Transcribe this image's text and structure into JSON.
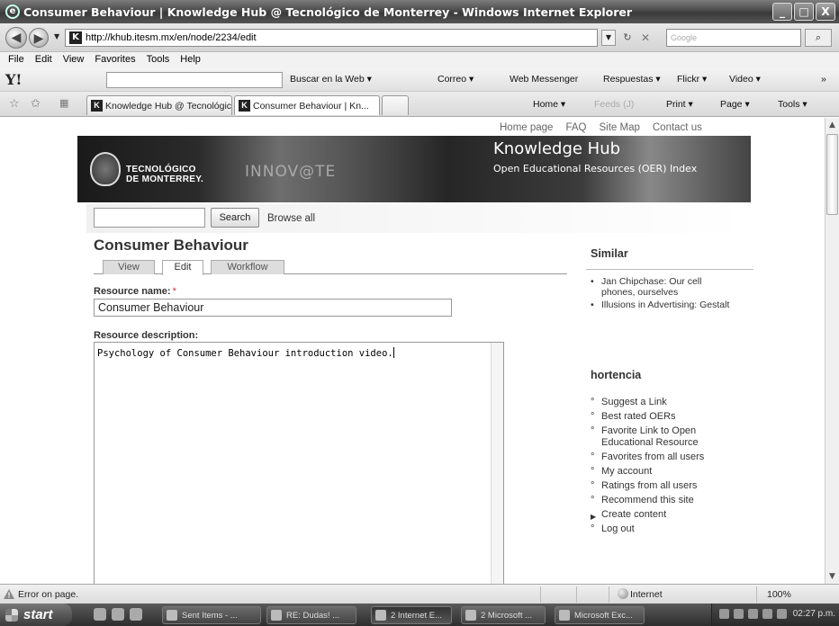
{
  "window": {
    "title": "Consumer Behaviour | Knowledge Hub @ Tecnológico de Monterrey - Windows Internet Explorer",
    "controls": [
      "_",
      "□",
      "X"
    ]
  },
  "address_bar": {
    "favicon": "K",
    "url": "http://khub.itesm.mx/en/node/2234/edit",
    "search_placeholder": "Google"
  },
  "menu": [
    "File",
    "Edit",
    "View",
    "Favorites",
    "Tools",
    "Help"
  ],
  "yahoo_toolbar": {
    "logo": "Y!",
    "items": [
      "Buscar en la Web ▾",
      "Correo ▾",
      "Web Messenger",
      "Respuestas ▾",
      "Flickr ▾",
      "Video ▾"
    ],
    "more": "»"
  },
  "tabs": [
    {
      "label": "Knowledge Hub @ Tecnológic...",
      "favicon": "K"
    },
    {
      "label": "Consumer Behaviour | Kn...",
      "favicon": "K"
    }
  ],
  "command_bar": {
    "home": "Home ▾",
    "feeds": "Feeds (J)",
    "print": "Print ▾",
    "page": "Page ▾",
    "tools": "Tools ▾"
  },
  "page": {
    "top_links": [
      "Home page",
      "FAQ",
      "Site Map",
      "Contact us"
    ],
    "banner": {
      "brand_line1": "TECNOLÓGICO",
      "brand_line2": "DE MONTERREY.",
      "innovate": "INNOV@TE",
      "title": "Knowledge Hub",
      "subtitle": "Open Educational Resources (OER) Index"
    },
    "search": {
      "button": "Search",
      "browse": "Browse all"
    },
    "node_title": "Consumer Behaviour",
    "node_tabs": [
      "View",
      "Edit",
      "Workflow"
    ],
    "form": {
      "name_label": "Resource name:",
      "required_mark": "*",
      "name_value": "Consumer Behaviour",
      "desc_label": "Resource description:",
      "desc_value": "Psychology of Consumer Behaviour introduction video."
    },
    "similar": {
      "heading": "Similar",
      "items": [
        "Jan Chipchase: Our cell phones, ourselves",
        "Illusions in Advertising: Gestalt"
      ]
    },
    "user_menu": {
      "heading": "hortencia",
      "items": [
        "Suggest a Link",
        "Best rated OERs",
        "Favorite Link to Open Educational Resource",
        "Favorites from all users",
        "My account",
        "Ratings from all users",
        "Recommend this site",
        "Create content",
        "Log out"
      ]
    }
  },
  "status_bar": {
    "message": "Error on page.",
    "zone": "Internet",
    "zoom": "100%"
  },
  "taskbar": {
    "start": "start",
    "tasks": [
      "Sent Items - ...",
      "RE: Dudas! ...",
      "2 Internet E...",
      "2 Microsoft ...",
      "Microsoft Exc..."
    ],
    "clock": "02:27 p.m."
  }
}
